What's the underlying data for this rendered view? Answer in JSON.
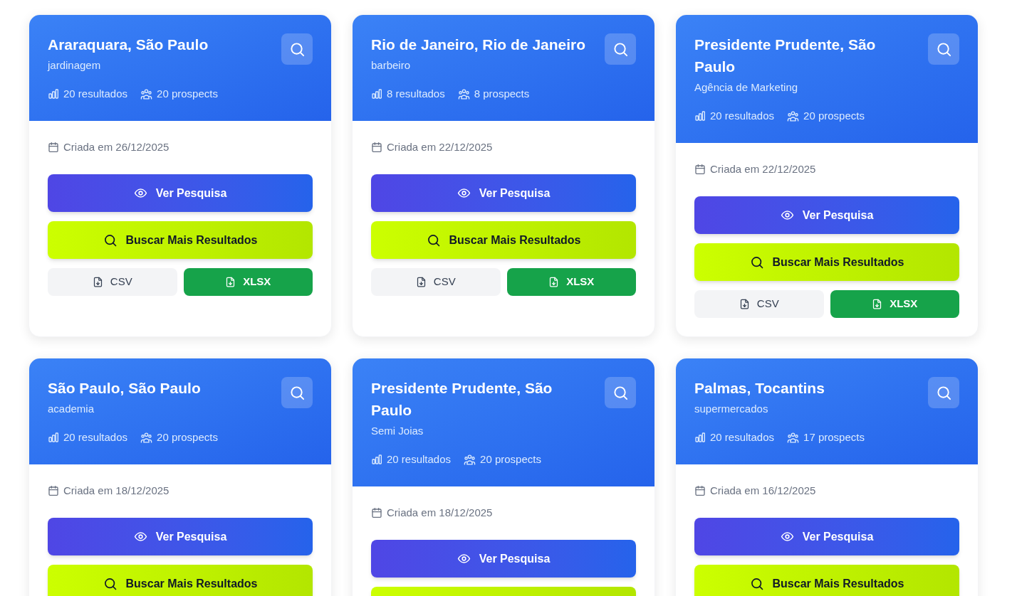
{
  "cards": [
    {
      "title": "Araraquara, São Paulo",
      "category": "jardinagem",
      "results": "20 resultados",
      "prospects": "20 prospects",
      "created": "Criada em 26/12/2025",
      "actions": [
        {
          "kind": "view",
          "label": "Ver Pesquisa"
        },
        {
          "kind": "search_more",
          "label": "Buscar Mais Resultados"
        },
        {
          "kind": "csv",
          "label": "CSV"
        },
        {
          "kind": "xlsx",
          "label": "XLSX"
        }
      ]
    },
    {
      "title": "Rio de Janeiro, Rio de Janeiro",
      "category": "barbeiro",
      "results": "8 resultados",
      "prospects": "8 prospects",
      "created": "Criada em 22/12/2025",
      "actions": [
        {
          "kind": "view",
          "label": "Ver Pesquisa"
        },
        {
          "kind": "search_more",
          "label": "Buscar Mais Resultados"
        },
        {
          "kind": "csv",
          "label": "CSV"
        },
        {
          "kind": "xlsx",
          "label": "XLSX"
        }
      ]
    },
    {
      "title": "Presidente Prudente, São Paulo",
      "category": "Agência de Marketing",
      "results": "20 resultados",
      "prospects": "20 prospects",
      "created": "Criada em 22/12/2025",
      "actions": [
        {
          "kind": "view",
          "label": "Ver Pesquisa"
        },
        {
          "kind": "search_more",
          "label": "Buscar Mais Resultados"
        },
        {
          "kind": "csv",
          "label": "CSV"
        },
        {
          "kind": "xlsx",
          "label": "XLSX"
        }
      ]
    },
    {
      "title": "São Paulo, São Paulo",
      "category": "academia",
      "results": "20 resultados",
      "prospects": "20 prospects",
      "created": "Criada em 18/12/2025",
      "actions": [
        {
          "kind": "view",
          "label": "Ver Pesquisa"
        },
        {
          "kind": "search_more",
          "label": "Buscar Mais Resultados"
        }
      ]
    },
    {
      "title": "Presidente Prudente, São Paulo",
      "category": "Semi Joias",
      "results": "20 resultados",
      "prospects": "20 prospects",
      "created": "Criada em 18/12/2025",
      "actions": [
        {
          "kind": "view",
          "label": "Ver Pesquisa"
        },
        {
          "kind": "search_more"
        }
      ]
    },
    {
      "title": "Palmas, Tocantins",
      "category": "supermercados",
      "results": "20 resultados",
      "prospects": "17 prospects",
      "created": "Criada em 16/12/2025",
      "actions": [
        {
          "kind": "view",
          "label": "Ver Pesquisa"
        },
        {
          "kind": "search_more",
          "label": "Buscar Mais Resultados"
        }
      ]
    }
  ]
}
